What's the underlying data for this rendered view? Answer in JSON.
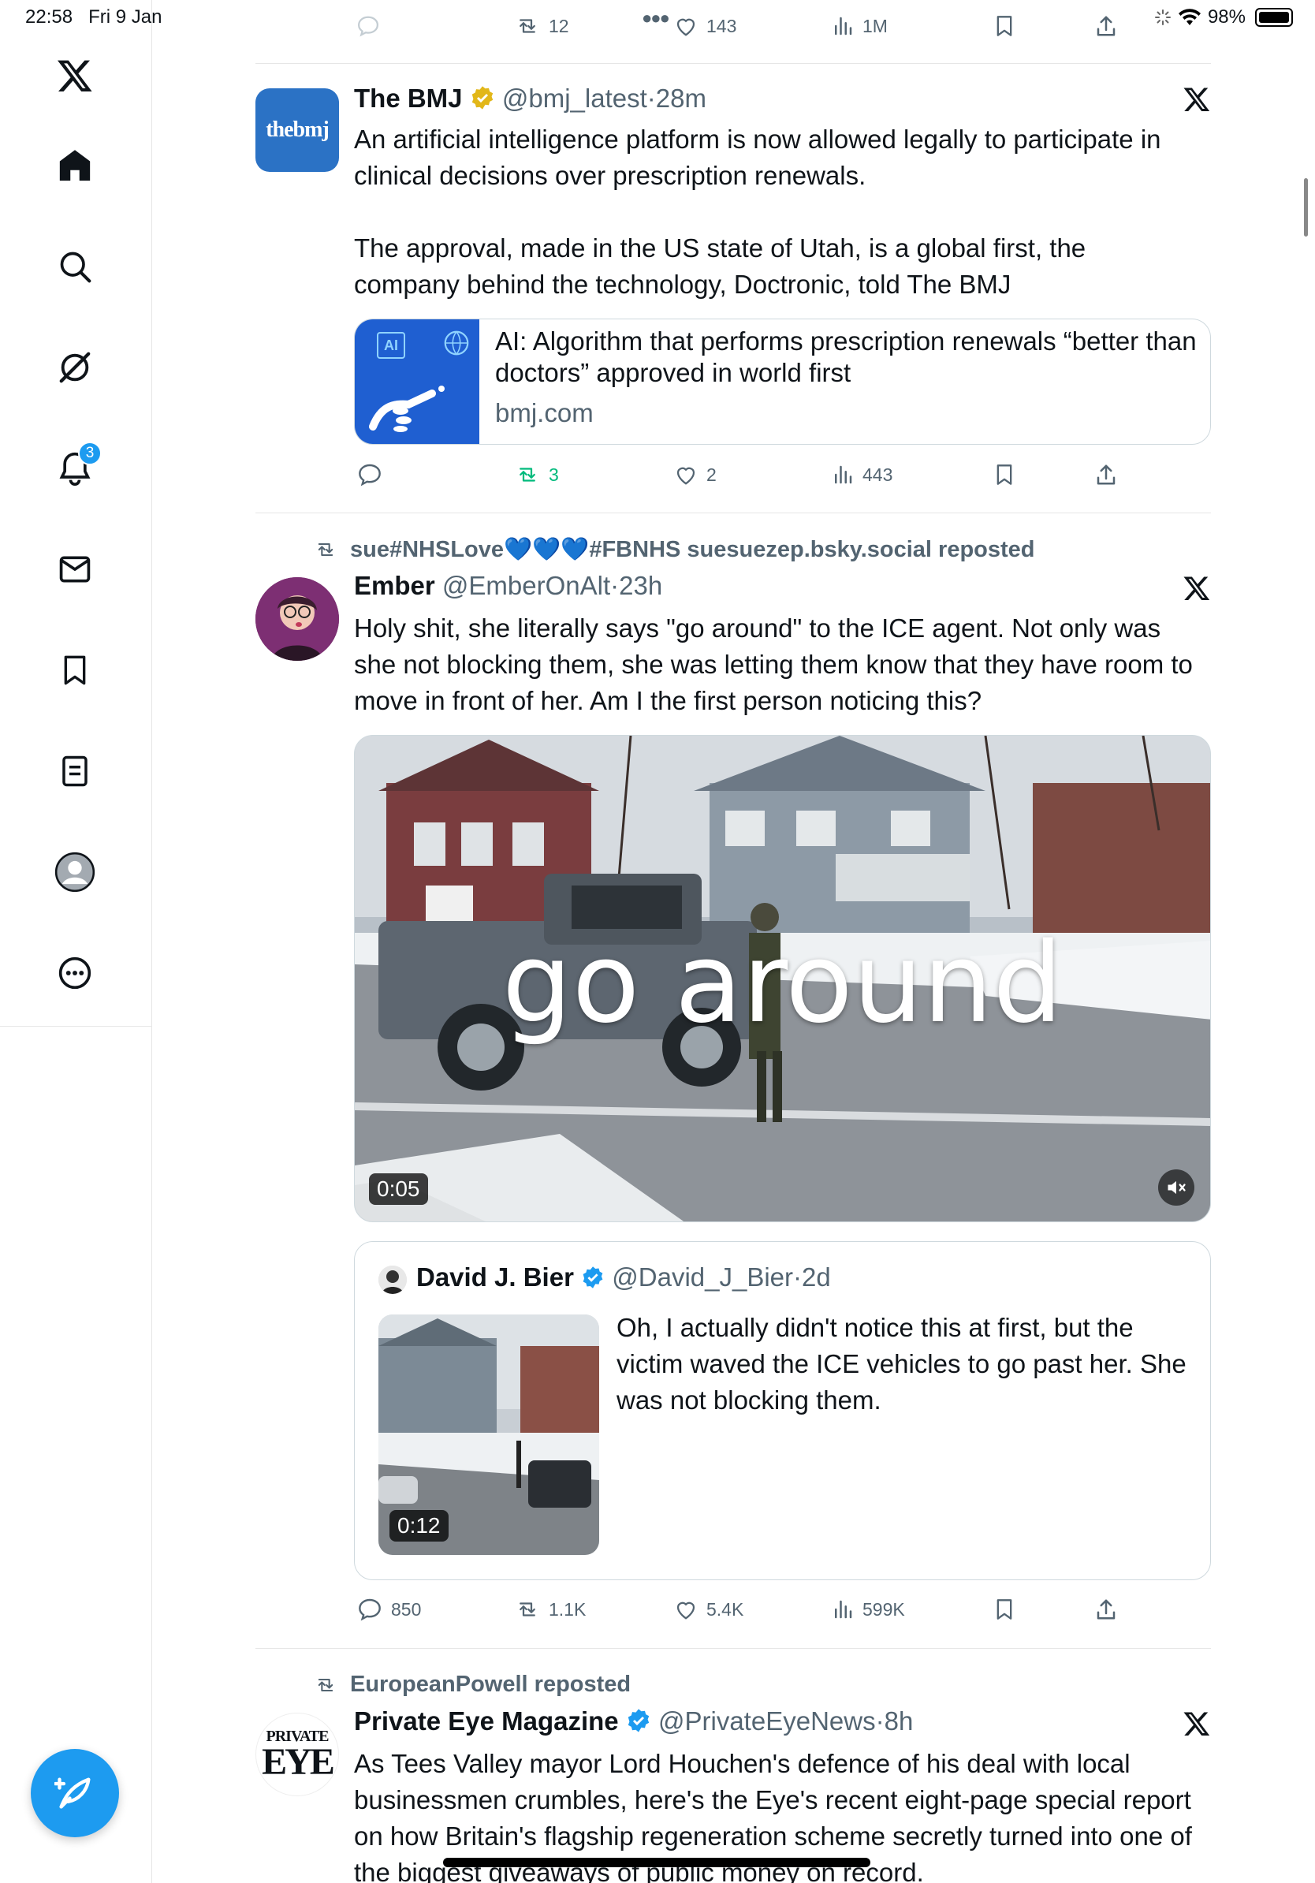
{
  "status_bar": {
    "time": "22:58",
    "date": "Fri 9 Jan",
    "battery": "98%"
  },
  "sidebar": {
    "items": [
      {
        "name": "x-logo-icon"
      },
      {
        "name": "home-icon"
      },
      {
        "name": "search-icon"
      },
      {
        "name": "grok-icon"
      },
      {
        "name": "notifications-icon",
        "badge": "3"
      },
      {
        "name": "messages-icon"
      },
      {
        "name": "bookmarks-icon"
      },
      {
        "name": "lists-icon"
      },
      {
        "name": "profile-icon"
      },
      {
        "name": "more-icon"
      }
    ],
    "compose_icon": "compose-post-icon"
  },
  "top_actions": {
    "retweets": "12",
    "likes": "143",
    "views": "1M"
  },
  "tweets": [
    {
      "name": "The BMJ",
      "handle": "@bmj_latest",
      "time": "28m",
      "avatar_text": "thebmj",
      "text1": "An artificial intelligence platform is now allowed legally to participate in clinical decisions over prescription renewals.",
      "text2": "The approval, made in the US state of Utah, is a global first, the company behind the technology, Doctronic, told The BMJ",
      "card": {
        "thumb_label": "AI",
        "title": "AI: Algorithm that performs prescription renewals “better than doctors” approved in world first",
        "domain": "bmj.com"
      },
      "actions": {
        "replies": "",
        "retweets": "3",
        "likes": "2",
        "views": "443"
      }
    },
    {
      "repost_by": "sue#NHSLove💙💙💙#FBNHS suesuezep.bsky.social reposted",
      "name": "Ember",
      "handle": "@EmberOnAlt",
      "time": "23h",
      "text": "Holy shit, she literally says \"go around\" to the ICE agent. Not only was she not blocking them, she was letting them know that they have room to move in front of her. Am I the first person noticing this?",
      "video": {
        "caption": "go around",
        "duration": "0:05"
      },
      "quote": {
        "name": "David J. Bier",
        "handle": "@David_J_Bier",
        "time": "2d",
        "text": "Oh, I actually didn't notice this at first, but the victim waved the ICE vehicles to go past her. She was not blocking them.",
        "duration": "0:12"
      },
      "actions": {
        "replies": "850",
        "retweets": "1.1K",
        "likes": "5.4K",
        "views": "599K"
      }
    },
    {
      "repost_by": "EuropeanPowell reposted",
      "name": "Private Eye Magazine",
      "handle": "@PrivateEyeNews",
      "time": "8h",
      "avatar_line1": "PRIVATE",
      "avatar_line2": "EYE",
      "text": "As Tees Valley mayor Lord Houchen's defence of his deal with local businessmen crumbles, here's the Eye's recent eight-page special report on how Britain's flagship regeneration scheme secretly turned into one of the biggest giveaways of public money on record."
    }
  ],
  "colors": {
    "accent": "#1d9bf0",
    "retweet_green": "#00ba7c",
    "muted": "#536471",
    "gold_check": "#e2b719"
  }
}
